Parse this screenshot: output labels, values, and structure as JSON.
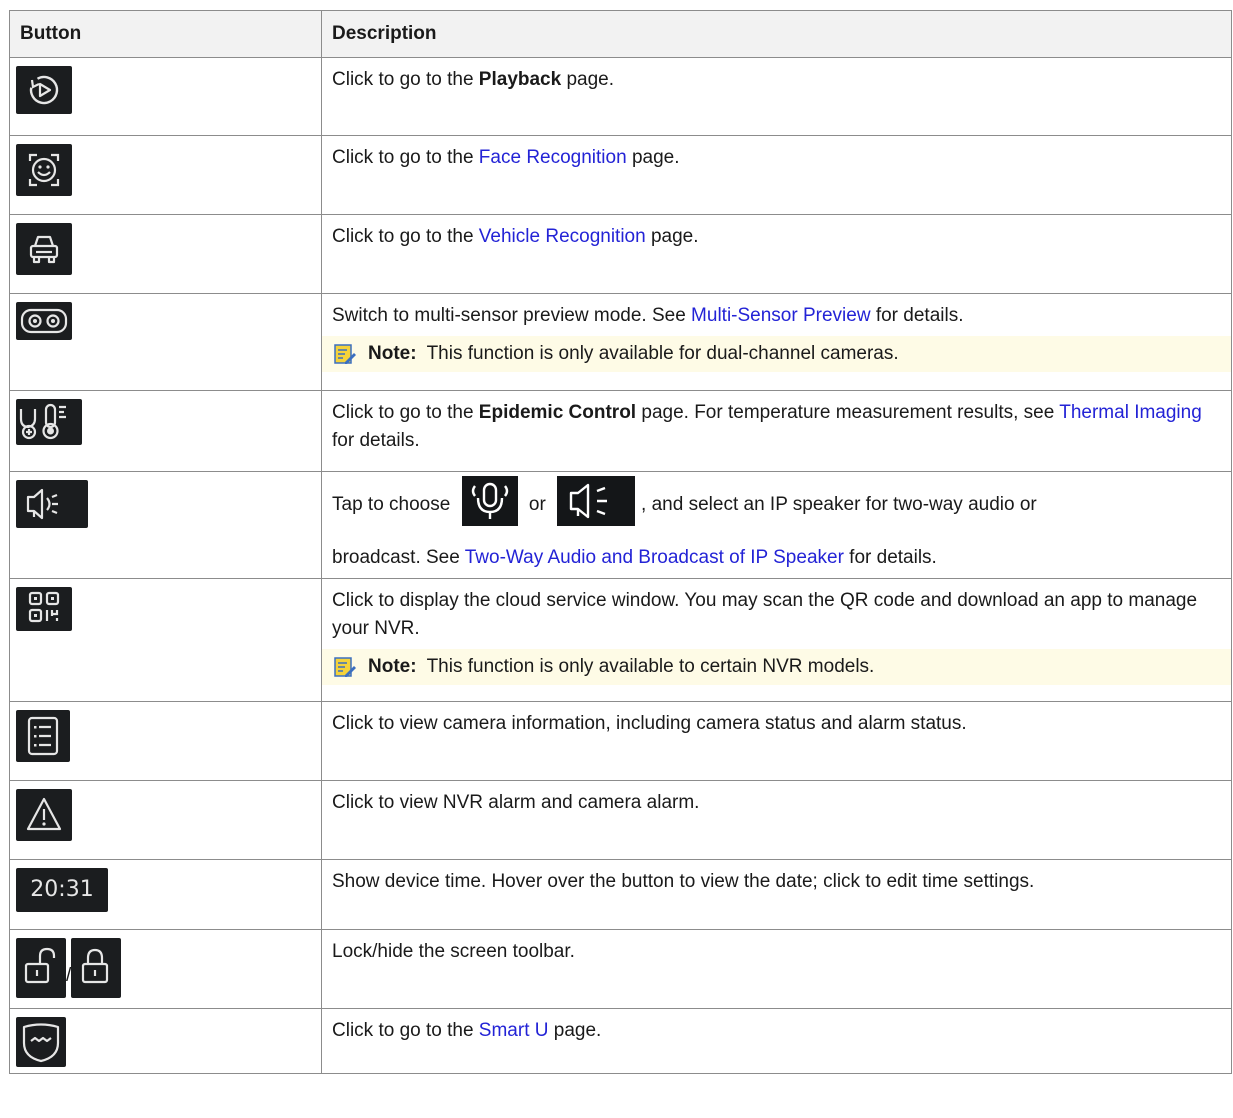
{
  "table": {
    "header": {
      "button": "Button",
      "description": "Description"
    },
    "rows": [
      {
        "icon": "playback-icon",
        "text_a": "Click to go to the ",
        "bold": "Playback",
        "text_b": " page."
      },
      {
        "icon": "face-recognition-icon",
        "text_a": "Click to go to the ",
        "link": "Face Recognition",
        "text_b": " page."
      },
      {
        "icon": "vehicle-recognition-icon",
        "text_a": "Click to go to the ",
        "link": "Vehicle Recognition",
        "text_b": " page."
      },
      {
        "icon": "multi-sensor-icon",
        "text_a": "Switch to multi-sensor preview mode. See ",
        "link": "Multi-Sensor Preview",
        "text_b": " for details.",
        "note_label": "Note:",
        "note_text": "This function is only available for dual-channel cameras."
      },
      {
        "icon": "epidemic-control-icon",
        "text_a": "Click to go to the ",
        "bold": "Epidemic Control",
        "text_b": " page. For temperature measurement results, see ",
        "link": "Thermal Imaging",
        "text_c": " for details."
      },
      {
        "icon": "speaker-icon",
        "text_a": "Tap to choose ",
        "or": " or ",
        "text_b": ", and select an IP speaker for two-way audio or",
        "text_c": "broadcast. See ",
        "link": "Two-Way Audio and Broadcast of IP Speaker",
        "text_d": " for details.",
        "inline_icons": [
          "microphone-icon",
          "speaker-wave-icon"
        ]
      },
      {
        "icon": "qr-code-icon",
        "text_a": "Click to display the cloud service window. You may scan the QR code and download an app to manage your NVR.",
        "note_label": "Note:",
        "note_text": "This function is only available to certain NVR models."
      },
      {
        "icon": "camera-list-icon",
        "text_a": "Click to view camera information, including camera status and alarm status."
      },
      {
        "icon": "alarm-warning-icon",
        "text_a": "Click to view NVR alarm and camera alarm."
      },
      {
        "icon": "device-time",
        "time": "20:31",
        "text_a": "Show device time. Hover over the button to view the date; click to edit time settings."
      },
      {
        "icon": "lock-icon",
        "separator": "/",
        "text_a": "Lock/hide the screen toolbar."
      },
      {
        "icon": "smart-u-icon",
        "text_a": "Click to go to the ",
        "link": "Smart U",
        "text_b": " page."
      }
    ]
  },
  "colors": {
    "link": "#2323d6",
    "header_bg": "#f2f2f2",
    "note_bg": "#fefbe6",
    "icon_bg": "#1b1d1f"
  }
}
